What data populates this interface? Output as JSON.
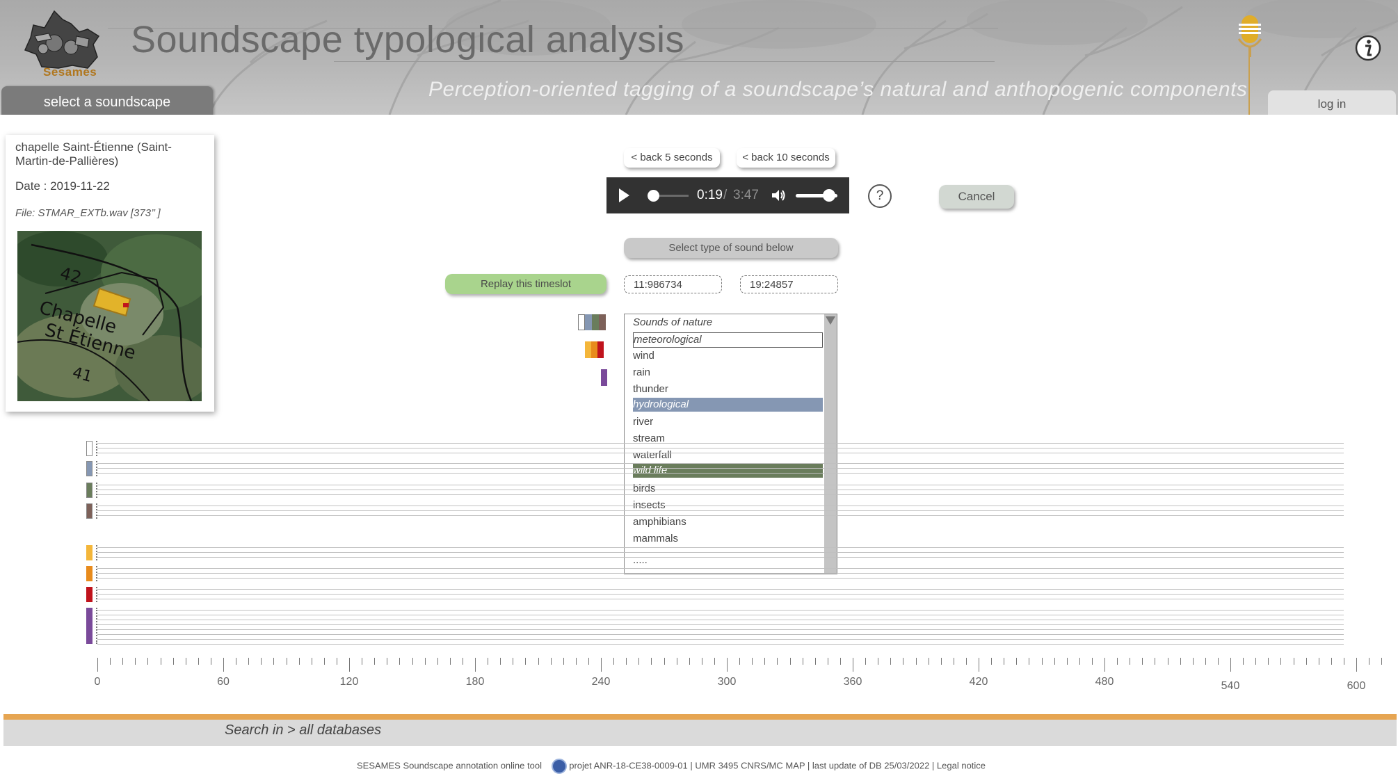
{
  "header": {
    "logo_text": "Sesames",
    "title": "Soundscape typological analysis",
    "subtitle": "Perception-oriented  tagging of a soundscape’s natural and anthopogenic components",
    "select_tab": "select a soundscape",
    "login_tab": "log in",
    "mic_icon": "microphone-icon",
    "info_icon": "info-icon"
  },
  "card": {
    "location": "chapelle Saint-Étienne (Saint-Martin-de-Pallières)",
    "date": "Date :  2019-11-22",
    "file": "File: STMAR_EXTb.wav [373’’ ]"
  },
  "controls": {
    "back5": "< back 5 seconds",
    "back10": "< back 10 seconds",
    "help": "?",
    "cancel": "Cancel",
    "select_type": "Select type of sound below",
    "replay": "Replay this timeslot",
    "time_start": "11:986734",
    "time_end": "19:24857"
  },
  "player": {
    "current": "0:19",
    "separator": "/",
    "duration": "3:47",
    "progress": 0.084,
    "volume": 0.8
  },
  "sound_list": [
    {
      "label": "Sounds of nature",
      "kind": "cat",
      "highlight": "",
      "boxed": false
    },
    {
      "label": "meteorological",
      "kind": "cat",
      "highlight": "",
      "boxed": true
    },
    {
      "label": "wind",
      "kind": "item",
      "highlight": "",
      "boxed": false
    },
    {
      "label": "rain",
      "kind": "item",
      "highlight": "",
      "boxed": false
    },
    {
      "label": "thunder",
      "kind": "item",
      "highlight": "",
      "boxed": false
    },
    {
      "label": "hydrological",
      "kind": "cat",
      "highlight": "#8597b3",
      "boxed": false
    },
    {
      "label": "river",
      "kind": "item",
      "highlight": "",
      "boxed": false
    },
    {
      "label": "stream",
      "kind": "item",
      "highlight": "",
      "boxed": false
    },
    {
      "label": "waterfall",
      "kind": "item",
      "highlight": "",
      "boxed": false
    },
    {
      "label": "wild life",
      "kind": "cat",
      "highlight": "#6a7d5c",
      "boxed": false
    },
    {
      "label": "birds",
      "kind": "item",
      "highlight": "",
      "boxed": false
    },
    {
      "label": "insects",
      "kind": "item",
      "highlight": "",
      "boxed": false
    },
    {
      "label": "amphibians",
      "kind": "item",
      "highlight": "",
      "boxed": false
    },
    {
      "label": "mammals",
      "kind": "item",
      "highlight": "",
      "boxed": false
    },
    {
      "label": ".....",
      "kind": "item",
      "highlight": "",
      "boxed": false
    }
  ],
  "legend_colors": {
    "group1": [
      "#ffffff",
      "#8597b3",
      "#6a7d5c",
      "#7d6159"
    ],
    "group2": [
      "#f4b63a",
      "#e88b1c",
      "#c0131c"
    ],
    "group3": [
      "#7a4a9a"
    ]
  },
  "track_colors": [
    "#ffffff",
    "#8597b3",
    "#6a7d5c",
    "#7d6159",
    "#f4b63a",
    "#e88b1c",
    "#c0131c",
    "#7a4a9a"
  ],
  "axis": {
    "labels": [
      "0",
      "60",
      "120",
      "180",
      "240",
      "300",
      "360",
      "420",
      "480",
      "540",
      "600"
    ]
  },
  "footer": {
    "search": "Search in > all databases",
    "tool": "SESAMES  Soundscape annotation online tool",
    "project": "projet ANR-18-CE38-0009-01   |   UMR 3495 CNRS/MC MAP   |    last update of DB   25/03/2022    |    Legal notice"
  },
  "colors": {
    "accent_orange": "#e6a552",
    "replay_green": "#a9d48d",
    "player_bg": "#323232"
  }
}
